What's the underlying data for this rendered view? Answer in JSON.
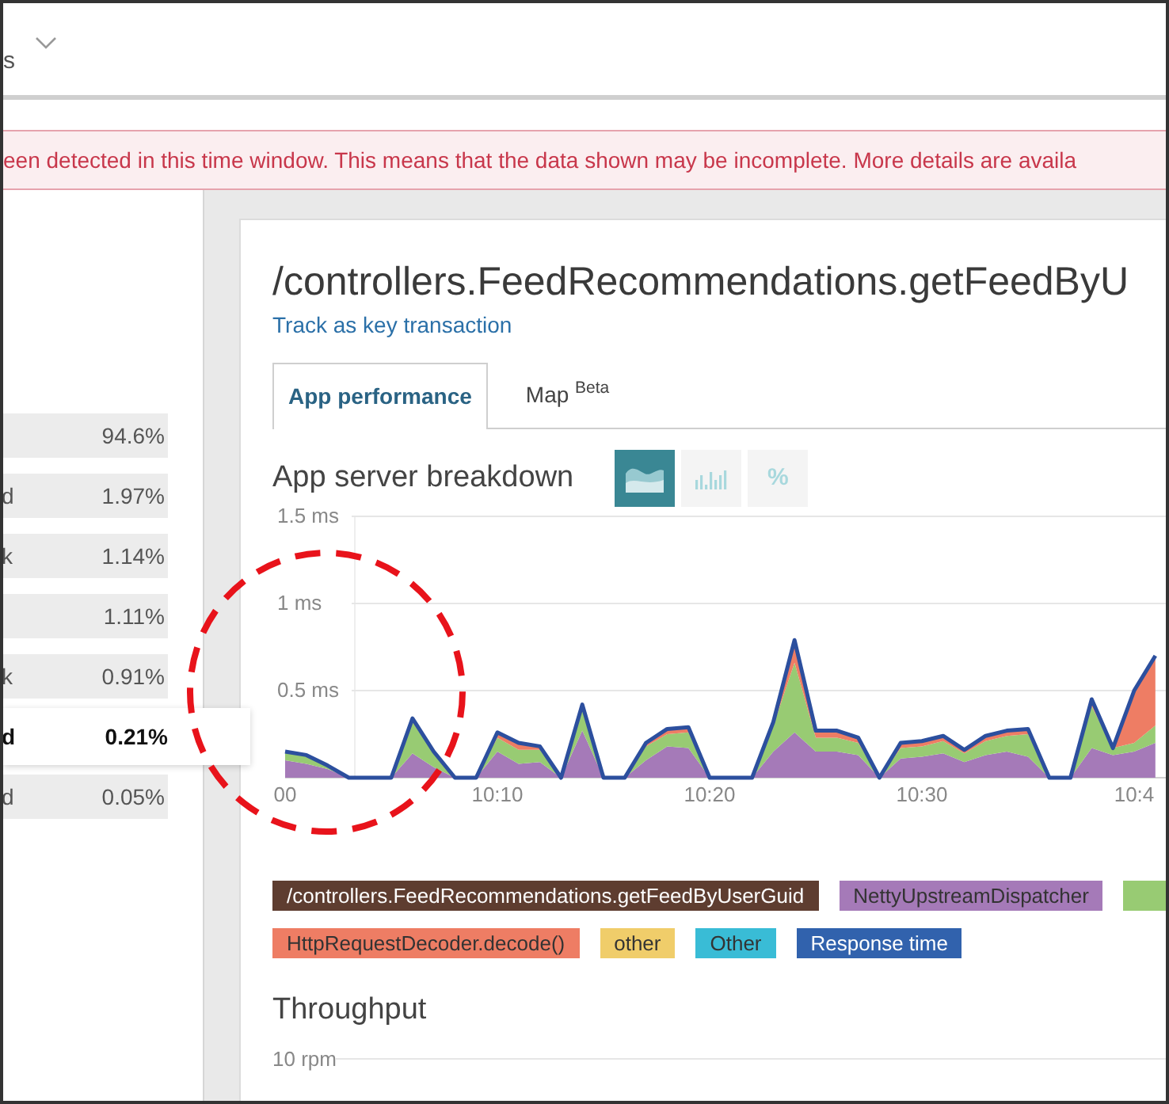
{
  "top_bar": {
    "label": "s"
  },
  "banner": {
    "text": "een detected in this time window. This means that the data shown may be incomplete. More details are availa"
  },
  "breakdown_list": [
    {
      "value": "94.6%",
      "selected": false
    },
    {
      "label": "d",
      "value": "1.97%",
      "selected": false
    },
    {
      "label": "k",
      "value": "1.14%",
      "selected": false
    },
    {
      "value": "1.11%",
      "selected": false
    },
    {
      "label": "k",
      "value": "0.91%",
      "selected": false
    },
    {
      "label": "d",
      "value": "0.21%",
      "selected": true
    },
    {
      "label": "d",
      "value": "0.05%",
      "selected": false
    }
  ],
  "transaction": {
    "title": "/controllers.FeedRecommendations.getFeedByU",
    "link": "Track as key transaction"
  },
  "tabs": [
    {
      "label": "App performance",
      "selected": true
    },
    {
      "label": "Map $^{Beta}$",
      "selected": false
    }
  ],
  "breakdown_chart": {
    "title": "App server breakdown",
    "view_buttons": [
      {
        "kind": "area",
        "selected": true
      },
      {
        "kind": "bars",
        "selected": false
      },
      {
        "kind": "percent",
        "label": "%",
        "selected": false
      }
    ],
    "chart_data": {
      "type": "area",
      "stacked": true,
      "ylim": [
        0,
        1.5
      ],
      "yticks": [
        {
          "value": 0.5,
          "label": "0.5 ms"
        },
        {
          "value": 1,
          "label": "1 ms"
        },
        {
          "value": 1.5,
          "label": "1.5 ms"
        }
      ],
      "categories": [
        "00",
        null,
        null,
        null,
        null,
        null,
        null,
        null,
        null,
        null,
        "10:10",
        null,
        null,
        null,
        null,
        null,
        null,
        null,
        null,
        null,
        "10:20",
        null,
        null,
        null,
        null,
        null,
        null,
        null,
        null,
        null,
        "10:30",
        null,
        null,
        null,
        null,
        null,
        null,
        null,
        null,
        null,
        "10:4",
        null
      ],
      "series": [
        {
          "color": "#a57ab8",
          "values": [
            0.1,
            0.08,
            0.05,
            0,
            0,
            0,
            0.14,
            0.06,
            0,
            0,
            0.15,
            0.08,
            0.09,
            0,
            0.27,
            0,
            0,
            0.1,
            0.18,
            0.17,
            0,
            0,
            0,
            0.15,
            0.26,
            0.15,
            0.15,
            0.13,
            0,
            0.11,
            0.12,
            0.14,
            0.09,
            0.13,
            0.15,
            0.12,
            0,
            0,
            0.17,
            0.13,
            0.15,
            0.2
          ]
        },
        {
          "color": "#98cb73",
          "values": [
            0.05,
            0.05,
            0.02,
            0,
            0,
            0,
            0.18,
            0.08,
            0,
            0,
            0.08,
            0.08,
            0.07,
            0,
            0.13,
            0,
            0,
            0.08,
            0.07,
            0.09,
            0,
            0,
            0,
            0.15,
            0.4,
            0.08,
            0.08,
            0.07,
            0,
            0.06,
            0.06,
            0.07,
            0.05,
            0.08,
            0.09,
            0.13,
            0,
            0,
            0.24,
            0.04,
            0.05,
            0.1
          ]
        },
        {
          "color": "#ee7d64",
          "values": [
            0,
            0,
            0,
            0,
            0,
            0,
            0.02,
            0.01,
            0,
            0,
            0.03,
            0.04,
            0.02,
            0,
            0.02,
            0,
            0,
            0.02,
            0.03,
            0.03,
            0,
            0,
            0,
            0.02,
            0.13,
            0.04,
            0.04,
            0.03,
            0,
            0.03,
            0.03,
            0.03,
            0.02,
            0.03,
            0.03,
            0.03,
            0,
            0,
            0.04,
            0,
            0.3,
            0.4
          ]
        }
      ]
    },
    "legend": [
      {
        "label": "/controllers.FeedRecommendations.getFeedByUserGuid",
        "color": "#5e3d30"
      },
      {
        "label": "NettyUpstreamDispatcher",
        "color": "#a57ab8"
      },
      {
        "color": "#98cb73"
      },
      {
        "label": "HttpRequestDecoder.decode()",
        "color": "#ee7d64"
      },
      {
        "label": "other",
        "color": "#f0cd6a"
      },
      {
        "label": "Other",
        "color": "#39bcd6"
      },
      {
        "label": "Response time",
        "color": "#3162ad"
      }
    ]
  },
  "throughput": {
    "title": "Throughput",
    "y_label": "10 rpm"
  }
}
